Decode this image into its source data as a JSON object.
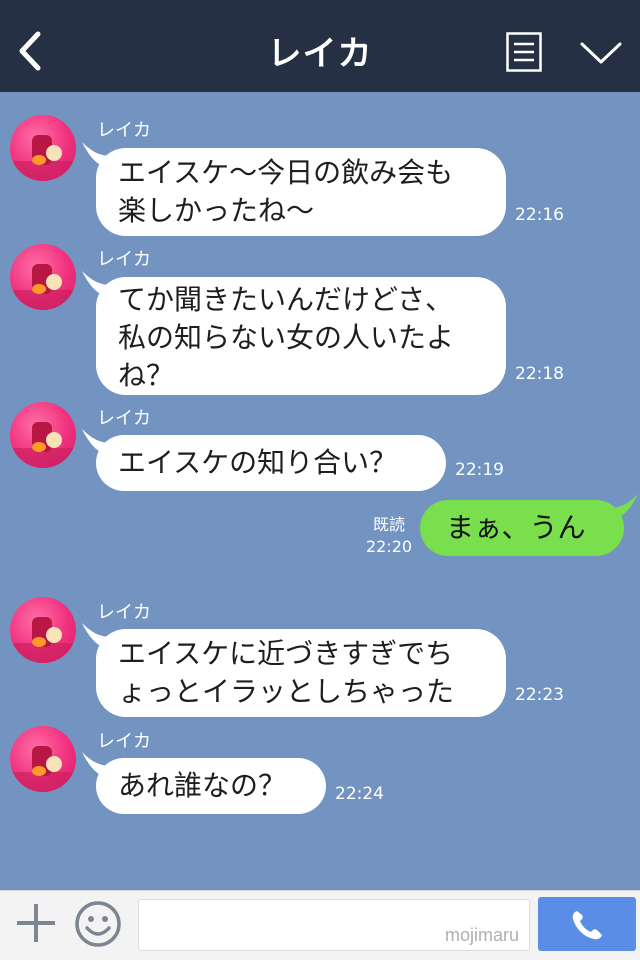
{
  "header": {
    "title": "レイカ",
    "back_icon": "chevron-left-icon",
    "note_icon": "notes-icon",
    "menu_icon": "chevron-down-icon"
  },
  "messages": [
    {
      "sender": "レイカ",
      "lines": [
        "エイスケ〜今日の飲み会も",
        "楽しかったね〜"
      ],
      "time": "22:16"
    },
    {
      "sender": "レイカ",
      "lines": [
        "てか聞きたいんだけどさ、",
        "私の知らない女の人いたよ",
        "ね？"
      ],
      "time": "22:18"
    },
    {
      "sender": "レイカ",
      "lines": [
        "エイスケの知り合い？"
      ],
      "time": "22:19"
    },
    {
      "sender": "me",
      "lines": [
        "まぁ、うん"
      ],
      "read": "既読",
      "time": "22:20"
    },
    {
      "sender": "レイカ",
      "lines": [
        "エイスケに近づきすぎでち",
        "ょっとイラッとしちゃった"
      ],
      "time": "22:23"
    },
    {
      "sender": "レイカ",
      "lines": [
        "あれ誰なの？"
      ],
      "time": "22:24"
    }
  ],
  "footer": {
    "plus_icon": "plus-icon",
    "emoji_icon": "smiley-icon",
    "input_value": "",
    "watermark": "mojimaru",
    "call_icon": "phone-icon"
  },
  "colors": {
    "header_bg": "#253044",
    "chat_bg": "#7394c1",
    "my_bubble": "#79df4d",
    "their_bubble": "#ffffff",
    "call_button": "#5a8ee6"
  }
}
